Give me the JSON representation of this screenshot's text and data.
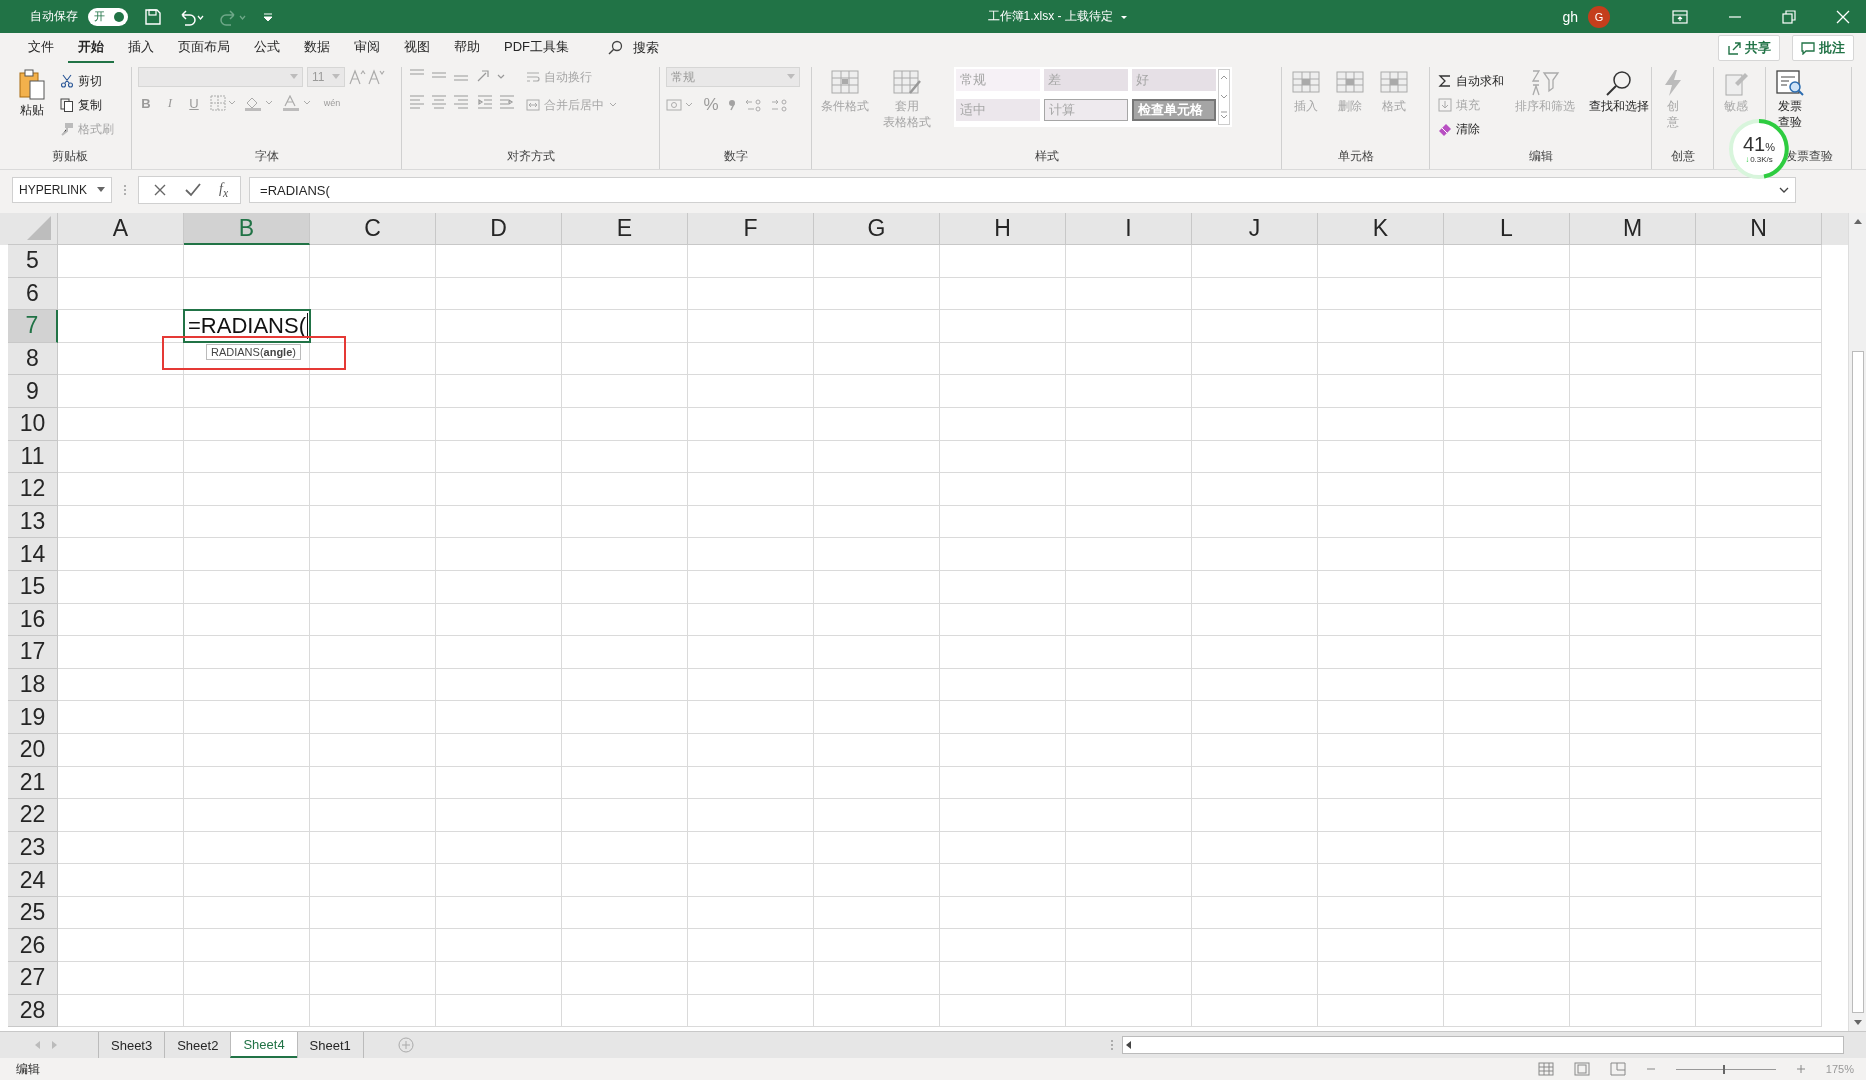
{
  "title_bar": {
    "autosave_label": "自动保存",
    "autosave_toggle": {
      "text": "开",
      "on": true
    },
    "title": "工作簿1.xlsx - 上载待定",
    "user": "gh",
    "avatar": "G"
  },
  "menu": {
    "tabs": [
      {
        "label": "文件",
        "selected": false
      },
      {
        "label": "开始",
        "selected": true
      },
      {
        "label": "插入",
        "selected": false
      },
      {
        "label": "页面布局",
        "selected": false
      },
      {
        "label": "公式",
        "selected": false
      },
      {
        "label": "数据",
        "selected": false
      },
      {
        "label": "审阅",
        "selected": false
      },
      {
        "label": "视图",
        "selected": false
      },
      {
        "label": "帮助",
        "selected": false
      },
      {
        "label": "PDF工具集",
        "selected": false
      }
    ],
    "search": "搜索",
    "share": "共享",
    "comments": "批注"
  },
  "ribbon": {
    "clipboard": {
      "label": "剪贴板",
      "paste": {
        "label": "粘贴",
        "disabled": false
      },
      "cut": {
        "label": "剪切",
        "disabled": false
      },
      "copy": {
        "label": "复制",
        "disabled": false
      },
      "format_painter": {
        "label": "格式刷",
        "disabled": true
      }
    },
    "font": {
      "label": "字体",
      "size": "11",
      "bold": "B",
      "italic": "I",
      "underline": "U",
      "phonetic": "wén",
      "disabled": true
    },
    "alignment": {
      "label": "对齐方式",
      "wrap": {
        "label": "自动换行",
        "disabled": true
      },
      "merge": {
        "label": "合并后居中",
        "disabled": true
      }
    },
    "number": {
      "label": "数字",
      "format": "常规",
      "percent": "%",
      "disabled": true
    },
    "styles": {
      "label": "样式",
      "conditional": {
        "label": "条件格式",
        "disabled": true
      },
      "table": {
        "lines": [
          "套用",
          "表格格式"
        ],
        "disabled": true
      },
      "gallery": [
        {
          "label": "常规",
          "color": "#f6f1f6"
        },
        {
          "label": "差",
          "color": "#e6e0e6"
        },
        {
          "label": "好",
          "color": "#e6e0e6"
        },
        {
          "label": "适中",
          "color": "#ece7ec"
        },
        {
          "label": "计算",
          "color": "#eeeaee"
        },
        {
          "label": "检查单元格",
          "color": "#a5a5a5"
        }
      ]
    },
    "cells": {
      "label": "单元格",
      "items": [
        {
          "label": "插入",
          "disabled": true
        },
        {
          "label": "删除",
          "disabled": true
        },
        {
          "label": "格式",
          "disabled": true
        }
      ]
    },
    "editing": {
      "label": "编辑",
      "autosum": {
        "label": "自动求和",
        "disabled": false
      },
      "fill": {
        "label": "填充",
        "disabled": true
      },
      "clear": {
        "label": "清除",
        "disabled": false
      },
      "sort": {
        "label": "排序和筛选",
        "disabled": true
      },
      "find": {
        "label": "查找和选择",
        "disabled": false
      }
    },
    "creative": {
      "label": "创意",
      "button": {
        "lines": [
          "创",
          "意"
        ],
        "disabled": true
      }
    },
    "sensitivity": {
      "button": {
        "label": "敏感",
        "disabled": true
      }
    },
    "invoice": {
      "label": "发票查验",
      "button": {
        "lines": [
          "发票",
          "查验"
        ],
        "disabled": false
      }
    }
  },
  "net_widget": {
    "percent": "41",
    "unit": "%",
    "arrow": "↓",
    "speed": "0.3K/s"
  },
  "formula_bar": {
    "name_box": "HYPERLINK",
    "fx": "f$_{x}$",
    "formula": "=RADIANS("
  },
  "grid": {
    "columns": [
      {
        "label": "A",
        "selected": false
      },
      {
        "label": "B",
        "selected": true
      },
      {
        "label": "C",
        "selected": false
      },
      {
        "label": "D",
        "selected": false
      },
      {
        "label": "E",
        "selected": false
      },
      {
        "label": "F",
        "selected": false
      },
      {
        "label": "G",
        "selected": false
      },
      {
        "label": "H",
        "selected": false
      },
      {
        "label": "I",
        "selected": false
      },
      {
        "label": "J",
        "selected": false
      },
      {
        "label": "K",
        "selected": false
      },
      {
        "label": "L",
        "selected": false
      },
      {
        "label": "M",
        "selected": false
      },
      {
        "label": "N",
        "selected": false
      }
    ],
    "rows": [
      {
        "label": "5",
        "selected": false
      },
      {
        "label": "6",
        "selected": false
      },
      {
        "label": "7",
        "selected": true
      },
      {
        "label": "8",
        "selected": false
      },
      {
        "label": "9",
        "selected": false
      },
      {
        "label": "10",
        "selected": false
      },
      {
        "label": "11",
        "selected": false
      },
      {
        "label": "12",
        "selected": false
      },
      {
        "label": "13",
        "selected": false
      },
      {
        "label": "14",
        "selected": false
      },
      {
        "label": "15",
        "selected": false
      },
      {
        "label": "16",
        "selected": false
      },
      {
        "label": "17",
        "selected": false
      },
      {
        "label": "18",
        "selected": false
      },
      {
        "label": "19",
        "selected": false
      },
      {
        "label": "20",
        "selected": false
      },
      {
        "label": "21",
        "selected": false
      },
      {
        "label": "22",
        "selected": false
      },
      {
        "label": "23",
        "selected": false
      },
      {
        "label": "24",
        "selected": false
      },
      {
        "label": "25",
        "selected": false
      },
      {
        "label": "26",
        "selected": false
      },
      {
        "label": "27",
        "selected": false
      },
      {
        "label": "28",
        "selected": false
      }
    ],
    "active_cell_text": "=RADIANS(",
    "tooltip": "RADIANS(**angle**)"
  },
  "sheets": [
    {
      "label": "Sheet3",
      "selected": false
    },
    {
      "label": "Sheet2",
      "selected": false
    },
    {
      "label": "Sheet4",
      "selected": true
    },
    {
      "label": "Sheet1",
      "selected": false
    }
  ],
  "status": {
    "mode": "编辑",
    "zoom": "175%",
    "zoom_slider": {
      "level": 0.47
    }
  }
}
